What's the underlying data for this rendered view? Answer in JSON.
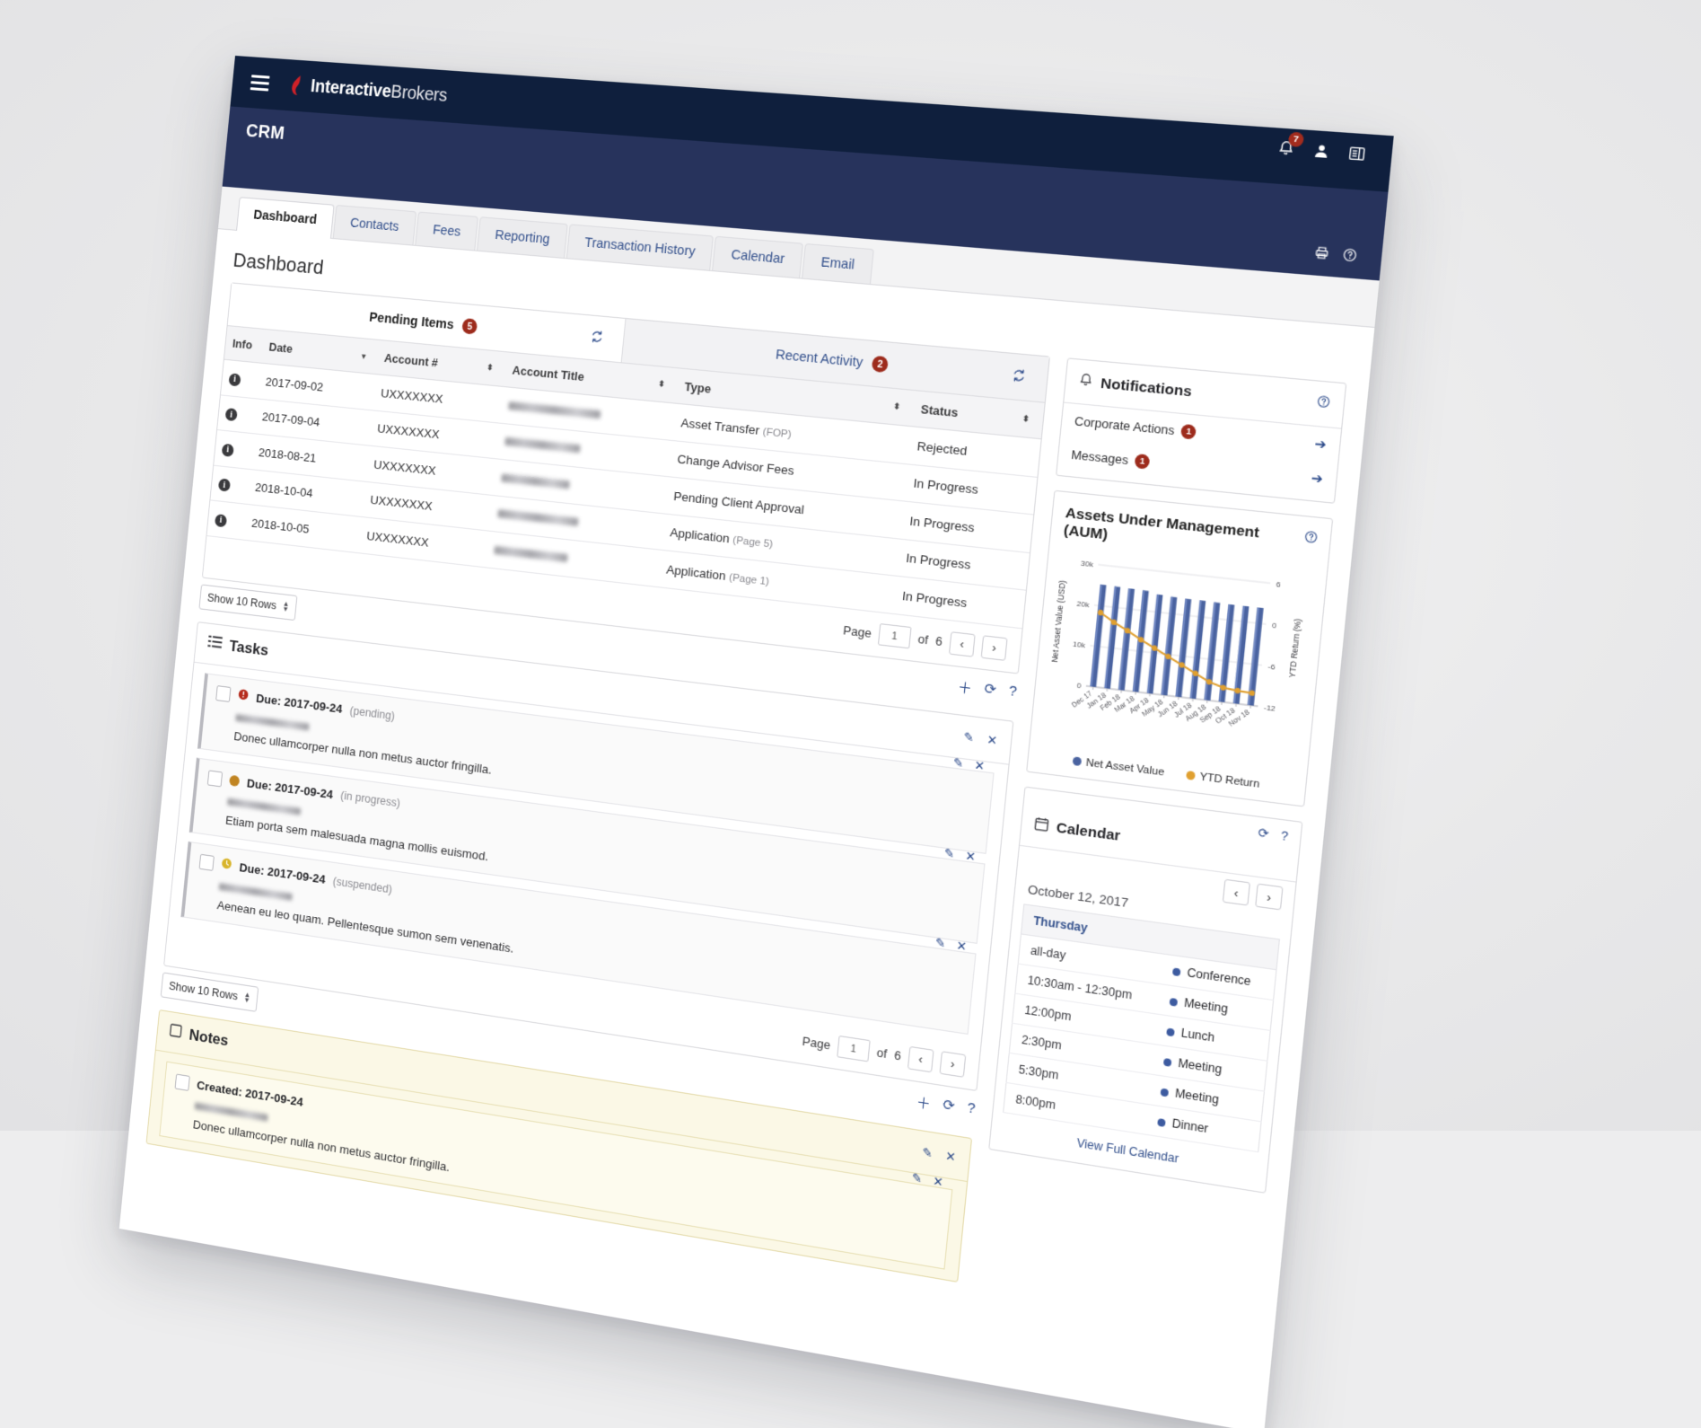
{
  "brand": {
    "name_bold": "Interactive",
    "name_light": "Brokers",
    "logo_icon": "ib-flame-logo"
  },
  "topnav": {
    "menu_icon": "hamburger-menu-icon",
    "notifications_icon": "bell-icon",
    "notifications_count": "7",
    "user_icon": "user-icon",
    "panel_icon": "panel-toggle-icon",
    "print_icon": "print-icon",
    "help_icon": "help-circle-icon"
  },
  "app_title": "CRM",
  "tabs": [
    {
      "label": "Dashboard",
      "active": true
    },
    {
      "label": "Contacts",
      "active": false
    },
    {
      "label": "Fees",
      "active": false
    },
    {
      "label": "Reporting",
      "active": false
    },
    {
      "label": "Transaction History",
      "active": false
    },
    {
      "label": "Calendar",
      "active": false
    },
    {
      "label": "Email",
      "active": false
    }
  ],
  "page_title": "Dashboard",
  "pending_panel": {
    "tab_pending": "Pending Items",
    "tab_pending_count": "5",
    "tab_recent": "Recent Activity",
    "tab_recent_count": "2",
    "refresh_icon": "refresh-icon",
    "columns": [
      "Info",
      "Date",
      "Account #",
      "Account Title",
      "Type",
      "Status"
    ],
    "rows": [
      {
        "date": "2017-09-02",
        "account": "UXXXXXXX",
        "type": "Asset Transfer",
        "type_note": "(FOP)",
        "status": "Rejected"
      },
      {
        "date": "2017-09-04",
        "account": "UXXXXXXX",
        "type": "Change Advisor Fees",
        "type_note": "",
        "status": "In Progress"
      },
      {
        "date": "2018-08-21",
        "account": "UXXXXXXX",
        "type": "Pending Client Approval",
        "type_note": "",
        "status": "In Progress"
      },
      {
        "date": "2018-10-04",
        "account": "UXXXXXXX",
        "type": "Application",
        "type_note": "(Page 5)",
        "status": "In Progress"
      },
      {
        "date": "2018-10-05",
        "account": "UXXXXXXX",
        "type": "Application",
        "type_note": "(Page 1)",
        "status": "In Progress"
      }
    ],
    "page_label": "Page",
    "page_value": "1",
    "page_of": "of",
    "page_total": "6",
    "prev_icon": "chevron-left-icon",
    "next_icon": "chevron-right-icon",
    "rows_select": "Show 10 Rows",
    "add_icon": "plus-icon",
    "refresh_icon2": "refresh-icon",
    "help_icon": "help-circle-icon"
  },
  "tasks_panel": {
    "icon": "list-icon",
    "title": "Tasks",
    "edit_icon": "pencil-icon",
    "close_icon": "close-x-icon",
    "items": [
      {
        "status_icon": "alert-exclamation-icon",
        "status_color": "#b52b1c",
        "due_label": "Due: 2017-09-24",
        "state": "(pending)",
        "text": "Donec ullamcorper nulla non metus auctor fringilla."
      },
      {
        "status_icon": "dot-filled-icon",
        "status_color": "#c08422",
        "due_label": "Due: 2017-09-24",
        "state": "(in progress)",
        "text": "Etiam porta sem malesuada magna mollis euismod."
      },
      {
        "status_icon": "clock-icon",
        "status_color": "#d8b42a",
        "due_label": "Due: 2017-09-24",
        "state": "(suspended)",
        "text": "Aenean eu leo quam. Pellentesque sumon sem venenatis."
      }
    ],
    "page_label": "Page",
    "page_value": "1",
    "page_of": "of",
    "page_total": "6",
    "rows_select": "Show 10 Rows"
  },
  "notes_panel": {
    "icon": "note-icon",
    "title": "Notes",
    "created_label": "Created: 2017-09-24",
    "text": "Donec ullamcorper nulla non metus auctor fringilla.",
    "edit_icon": "pencil-icon",
    "close_icon": "close-x-icon"
  },
  "notifications_panel": {
    "icon": "bell-icon",
    "title": "Notifications",
    "help_icon": "help-circle-icon",
    "rows": [
      {
        "label": "Corporate Actions",
        "count": "1",
        "arrow_icon": "arrow-right-circle-icon"
      },
      {
        "label": "Messages",
        "count": "1",
        "arrow_icon": "arrow-right-circle-icon"
      }
    ]
  },
  "aum_panel": {
    "title": "Assets Under Management (AUM)",
    "help_icon": "help-circle-icon"
  },
  "calendar_panel": {
    "icon": "calendar-icon",
    "title": "Calendar",
    "refresh_icon": "refresh-icon",
    "help_icon": "help-circle-icon",
    "prev_icon": "chevron-left-icon",
    "next_icon": "chevron-right-icon",
    "date": "October 12, 2017",
    "day_header": "Thursday",
    "events": [
      {
        "time": "all-day",
        "title": "Conference"
      },
      {
        "time": "10:30am - 12:30pm",
        "title": "Meeting"
      },
      {
        "time": "12:00pm",
        "title": "Lunch"
      },
      {
        "time": "2:30pm",
        "title": "Meeting"
      },
      {
        "time": "5:30pm",
        "title": "Meeting"
      },
      {
        "time": "8:00pm",
        "title": "Dinner"
      }
    ],
    "view_full": "View Full Calendar"
  },
  "colors": {
    "navy": "#0f1f3d",
    "navy_light": "#27335c",
    "accent_red": "#9d2b1c",
    "link_blue": "#33508c",
    "bar_blue": "#4a63a0",
    "line_orange": "#e0a030"
  },
  "chart_data": {
    "type": "bar",
    "title": "Assets Under Management (AUM)",
    "xlabel": "",
    "ylabel": "Net Asset Value (USD)",
    "y2label": "YTD Return (%)",
    "ylim": [
      0,
      30000
    ],
    "yticks": [
      "0",
      "10k",
      "20k",
      "30k"
    ],
    "y2lim": [
      -12,
      6
    ],
    "y2ticks": [
      "6",
      "0",
      "-6",
      "-12"
    ],
    "categories": [
      "Dec 17",
      "Jan 18",
      "Feb 18",
      "Mar 18",
      "Apr 18",
      "May 18",
      "Jun 18",
      "Jul 18",
      "Aug 18",
      "Sep 18",
      "Oct 18",
      "Nov 18"
    ],
    "series": [
      {
        "name": "Net Asset Value",
        "type": "bar",
        "color": "#4a63a0",
        "axis": "left",
        "values": [
          25200,
          25100,
          25000,
          24900,
          24300,
          24100,
          24000,
          24000,
          23900,
          23800,
          23800,
          23800
        ]
      },
      {
        "name": "YTD Return",
        "type": "line",
        "color": "#e0a030",
        "axis": "right",
        "values": [
          -1.0,
          -2.2,
          -3.2,
          -4.3,
          -5.3,
          -6.3,
          -7.3,
          -8.3,
          -9.3,
          -9.9,
          -10.1,
          -10.2
        ]
      }
    ],
    "legend": [
      "Net Asset Value",
      "YTD Return"
    ],
    "legend_position": "bottom",
    "grid": true
  }
}
